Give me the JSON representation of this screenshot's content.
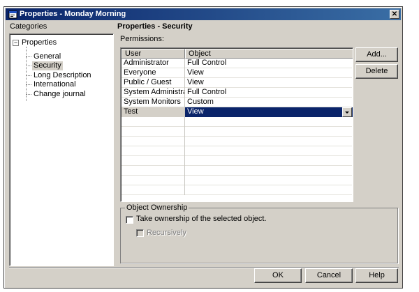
{
  "window": {
    "title": "Properties - Monday Morning",
    "close_glyph": "✕"
  },
  "sidebar": {
    "label": "Categories",
    "root": "Properties",
    "expander": "−",
    "items": [
      "General",
      "Security",
      "Long Description",
      "International",
      "Change journal"
    ],
    "selected": "Security"
  },
  "main": {
    "title": "Properties - Security",
    "permissions_label": "Permissions:",
    "columns": [
      "User",
      "Object"
    ],
    "rows": [
      {
        "user": "Administrator",
        "object": "Full Control"
      },
      {
        "user": "Everyone",
        "object": "View"
      },
      {
        "user": "Public / Guest",
        "object": "View"
      },
      {
        "user": "System Administrators",
        "object": "Full Control"
      },
      {
        "user": "System Monitors",
        "object": "Custom"
      },
      {
        "user": "Test",
        "object": "View"
      }
    ],
    "selected_row": 5,
    "add_label": "Add...",
    "delete_label": "Delete"
  },
  "ownership": {
    "legend": "Object Ownership",
    "take_label": "Take ownership of the selected object.",
    "recursive_label": "Recursively"
  },
  "footer": {
    "ok": "OK",
    "cancel": "Cancel",
    "help": "Help"
  },
  "colors": {
    "title_bar": "#0a246a",
    "selection": "#0a246a",
    "dialog_bg": "#d4d0c8"
  }
}
